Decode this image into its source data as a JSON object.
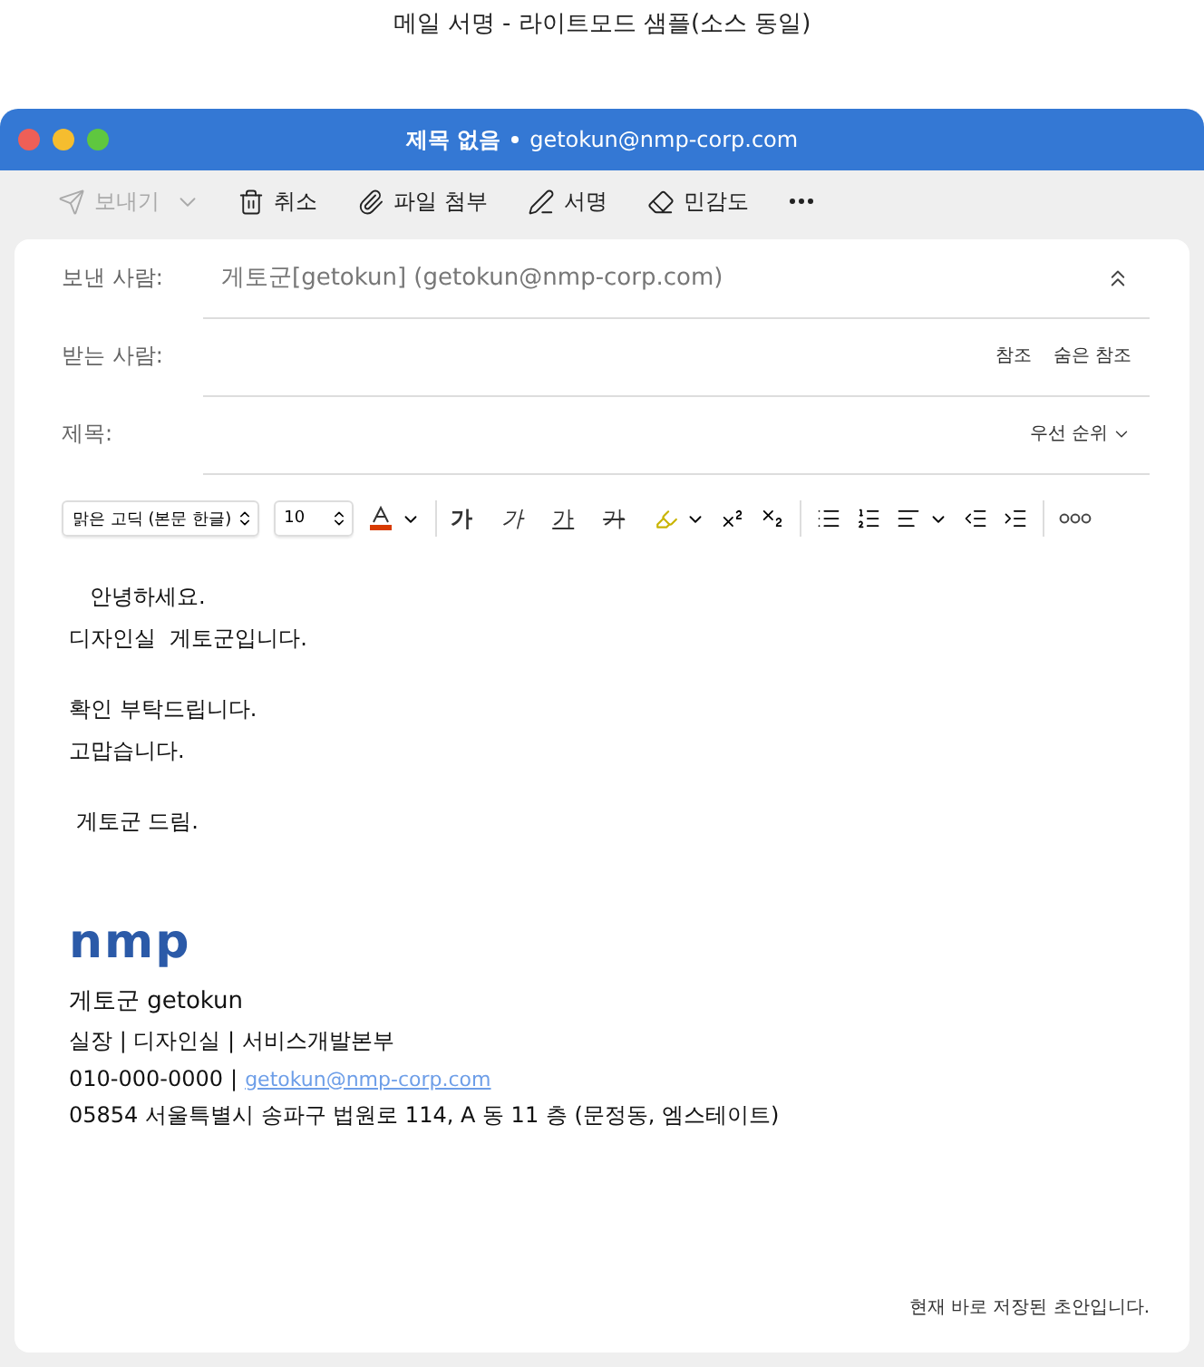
{
  "caption": "메일 서명 - 라이트모드 샘플(소스 동일)",
  "window": {
    "title": "제목 없음",
    "modified": true,
    "account": "getokun@nmp-corp.com"
  },
  "toolbar": [
    {
      "kind": "send",
      "label": "보내기",
      "disabled": true
    },
    {
      "kind": "discard",
      "label": "취소",
      "disabled": false
    },
    {
      "kind": "attach",
      "label": "파일 첨부",
      "disabled": false
    },
    {
      "kind": "signature",
      "label": "서명",
      "disabled": false
    },
    {
      "kind": "sensitivity",
      "label": "민감도",
      "disabled": false
    },
    {
      "kind": "more",
      "disabled": false
    }
  ],
  "header": {
    "from": {
      "label": "보낸 사람:",
      "value": "게토군[getokun] (getokun@nmp-corp.com)"
    },
    "to": {
      "label": "받는 사람:",
      "cc": "참조",
      "bcc": "숨은 참조"
    },
    "subject": {
      "label": "제목:",
      "priority": "우선 순위"
    }
  },
  "format_bar": {
    "font": "맑은 고딕 (본문 한글)",
    "size": "10",
    "text_styles": [
      {
        "kind": "bold",
        "label": "가"
      },
      {
        "kind": "italic",
        "label": "가"
      },
      {
        "kind": "underline",
        "label": "가"
      },
      {
        "kind": "strike",
        "label": "가"
      }
    ]
  },
  "body": [
    [
      "   안녕하세요.",
      "디자인실  게토군입니다."
    ],
    [
      "확인 부탁드립니다.",
      "고맙습니다."
    ],
    [
      " 게토군 드림."
    ]
  ],
  "signature": {
    "logo": "nmp",
    "name": "게토군 getokun",
    "position": "실장 | 디자인실 | 서비스개발본부",
    "phone": "010-000-0000",
    "separator": "|",
    "email": "getokun@nmp-corp.com",
    "address": "05854 서울특별시 송파구 법원로 114, A 동 11 층 (문정동, 엠스테이트)"
  },
  "status": "현재 바로 저장된 초안입니다."
}
